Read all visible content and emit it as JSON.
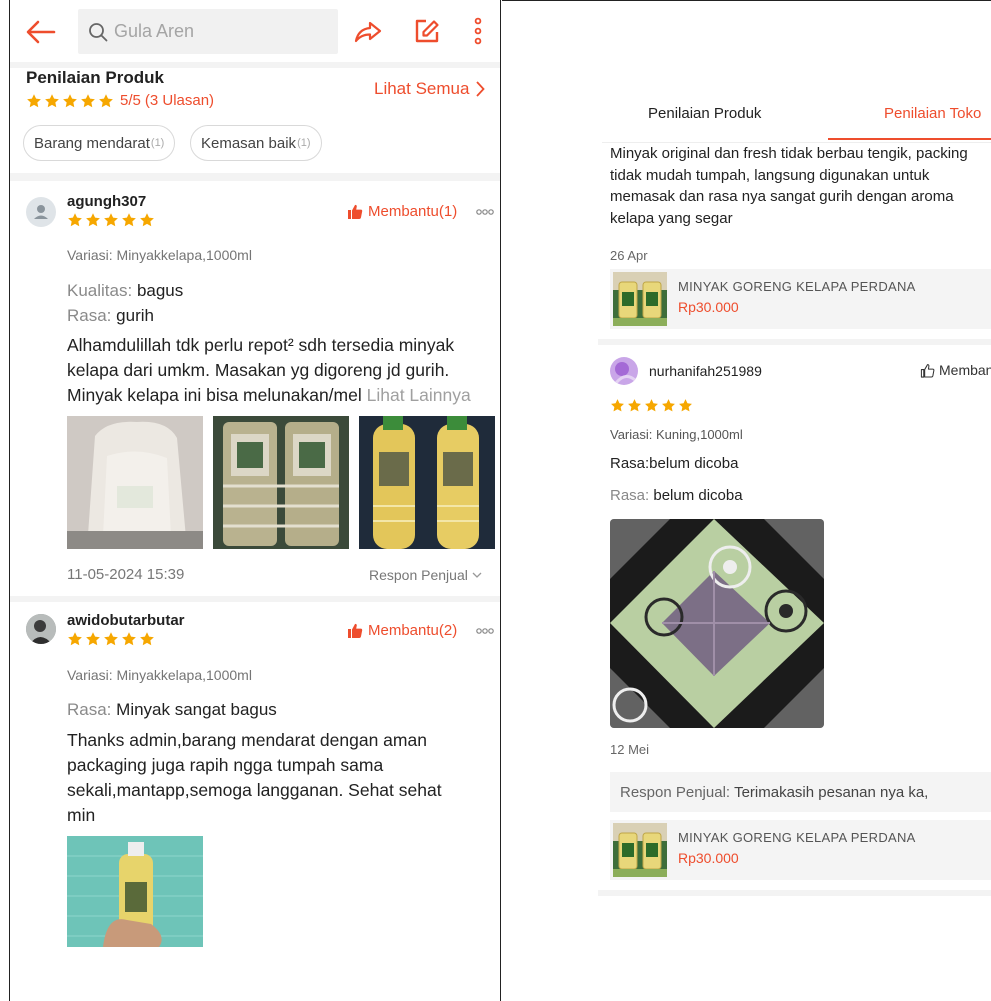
{
  "colors": {
    "accent": "#ee4d2d",
    "star": "#f6a700"
  },
  "left": {
    "search": {
      "placeholder": "Gula Aren"
    },
    "icons": [
      "back-arrow-icon",
      "search-icon",
      "share-icon",
      "edit-icon",
      "more-vertical-icon"
    ],
    "section_title": "Penilaian Produk",
    "rating": {
      "stars": 5,
      "score": "5/5",
      "count": "(3 Ulasan)"
    },
    "see_all": "Lihat Semua",
    "filters": [
      {
        "label": "Barang mendarat",
        "count": "(1)"
      },
      {
        "label": "Kemasan baik",
        "count": "(1)"
      }
    ],
    "reviews": [
      {
        "username": "agungh307",
        "stars": 5,
        "helpful": "Membantu(1)",
        "variant": "Variasi: Minyakkelapa,1000ml",
        "attrs": [
          {
            "key": "Kualitas:",
            "value": "bagus"
          },
          {
            "key": "Rasa:",
            "value": "gurih"
          }
        ],
        "lines": [
          "Alhamdulillah tdk perlu repot² sdh tersedia minyak",
          "kelapa dari umkm. Masakan yg digoreng jd gurih.",
          "Minyak kelapa ini bisa melunakan/mel"
        ],
        "more": "Lihat Lainnya",
        "date": "11-05-2024 15:39",
        "respon": "Respon Penjual"
      },
      {
        "username": "awidobutarbutar",
        "stars": 5,
        "helpful": "Membantu(2)",
        "variant": "Variasi: Minyakkelapa,1000ml",
        "attrs": [
          {
            "key": "Rasa:",
            "value": "Minyak sangat bagus"
          }
        ],
        "lines": [
          "Thanks admin,barang mendarat dengan aman",
          "packaging juga rapih ngga tumpah sama",
          "sekali,mantapp,semoga langganan. Sehat sehat",
          "min"
        ]
      }
    ]
  },
  "right": {
    "tabs": [
      {
        "label": "Penilaian Produk",
        "active": false
      },
      {
        "label": "Penilaian Toko",
        "active": true
      }
    ],
    "review_top": {
      "lines": [
        "Minyak original dan fresh tidak berbau tengik, packing",
        "tidak mudah tumpah, langsung digunakan untuk",
        "memasak dan rasa nya sangat gurih dengan aroma",
        "kelapa yang segar"
      ],
      "date": "26 Apr",
      "product": {
        "name": "MINYAK GORENG KELAPA PERDANA",
        "price": "Rp30.000"
      }
    },
    "review_2": {
      "username": "nurhanifah251989",
      "helpful": "Membantu",
      "stars": 5,
      "variant": "Variasi: Kuning,1000ml",
      "line1": "Rasa:belum dicoba",
      "attr": {
        "key": "Rasa:",
        "value": "belum dicoba"
      },
      "date": "12 Mei",
      "seller_reply": {
        "key": "Respon Penjual:",
        "value": "Terimakasih pesanan nya ka,"
      },
      "product": {
        "name": "MINYAK GORENG KELAPA PERDANA",
        "price": "Rp30.000"
      }
    }
  }
}
